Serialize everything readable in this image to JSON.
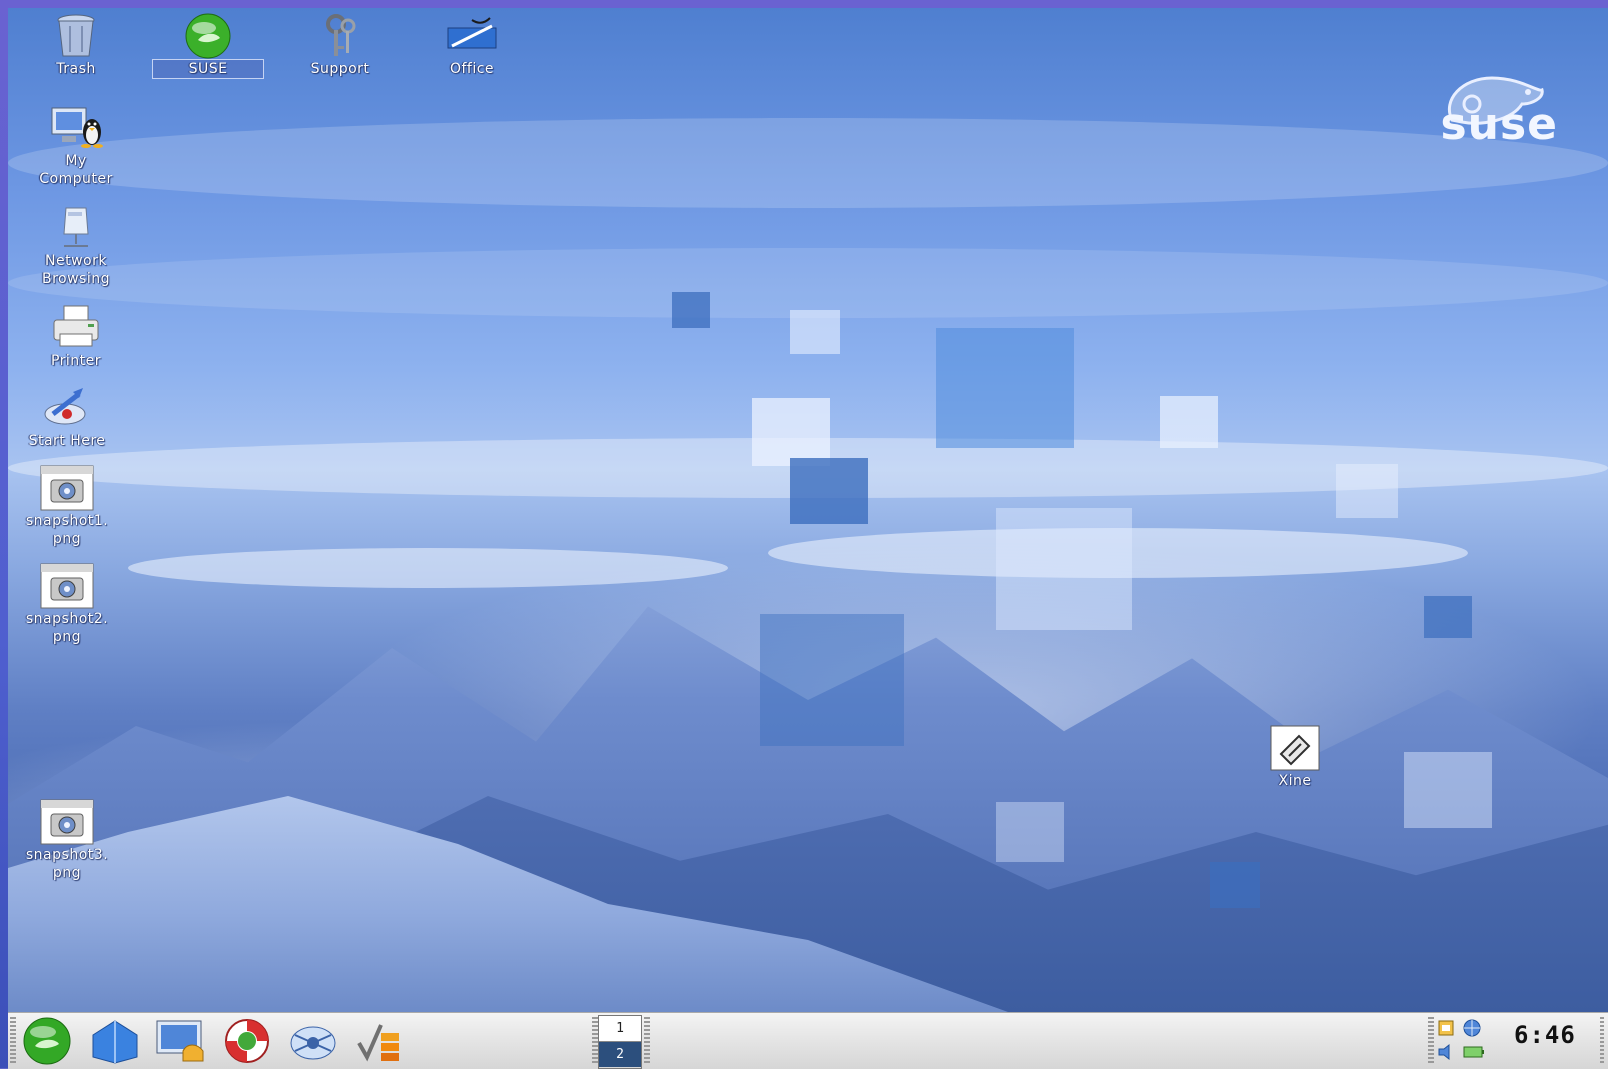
{
  "desktop": {
    "icons": [
      {
        "label": "Trash",
        "icon": "trash-icon"
      },
      {
        "label": "SUSE",
        "icon": "suse-icon"
      },
      {
        "label": "Support",
        "icon": "support-keys-icon"
      },
      {
        "label": "Office",
        "icon": "office-icon"
      },
      {
        "label": "My Computer",
        "icon": "my-computer-icon"
      },
      {
        "label": "Network Browsing",
        "icon": "network-icon"
      },
      {
        "label": "Printer",
        "icon": "printer-icon"
      },
      {
        "label": "Start Here",
        "icon": "start-here-icon"
      },
      {
        "label": "snapshot1.png",
        "icon": "image-file-icon"
      },
      {
        "label": "snapshot2.png",
        "icon": "image-file-icon"
      },
      {
        "label": "snapshot3.png",
        "icon": "image-file-icon"
      },
      {
        "label": "Xine",
        "icon": "xine-icon"
      }
    ],
    "brand": "suse"
  },
  "taskbar": {
    "launchers": [
      {
        "name": "suse-menu-icon"
      },
      {
        "name": "home-folder-icon"
      },
      {
        "name": "desktop-icon"
      },
      {
        "name": "help-lifebuoy-icon"
      },
      {
        "name": "konqueror-icon"
      },
      {
        "name": "office-launcher-icon"
      }
    ],
    "pager": {
      "desk1": "1",
      "desk2": "2"
    },
    "clock": "6:46"
  },
  "colors": {
    "sky": "#6d97e3",
    "taskbar": "#e4e4e4",
    "pager_active": "#2c4f7d",
    "frame": "#5f67c7"
  }
}
